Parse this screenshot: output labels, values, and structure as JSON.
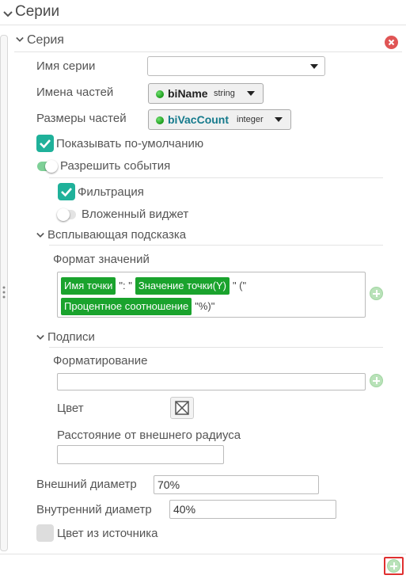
{
  "section": {
    "title": "Серии"
  },
  "series": {
    "title": "Серия",
    "name_label": "Имя серии",
    "name_value": "",
    "parts_names_label": "Имена частей",
    "parts_names_field": {
      "name": "biName",
      "type": "string"
    },
    "parts_sizes_label": "Размеры частей",
    "parts_sizes_field": {
      "name": "biVacCount",
      "type": "integer"
    },
    "show_default_label": "Показывать по-умолчанию",
    "show_default_checked": true,
    "allow_events_label": "Разрешить события",
    "allow_events_on": true,
    "filtering_label": "Фильтрация",
    "filtering_checked": true,
    "nested_widget_label": "Вложенный виджет",
    "nested_widget_on": false
  },
  "tooltip": {
    "title": "Всплывающая подсказка",
    "format_label": "Формат значений",
    "tokens": {
      "point_name": "Имя точки",
      "sep1": "\": \"",
      "point_value": "Значение точки(Y)",
      "sep2": "\" (\"",
      "percent": "Процентное соотношение",
      "sep3": "\"%)\""
    }
  },
  "labels": {
    "title": "Подписи",
    "formatting_label": "Форматирование",
    "formatting_value": "",
    "color_label": "Цвет",
    "outer_distance_label": "Расстояние от внешнего радиуса",
    "outer_distance_value": ""
  },
  "diameters": {
    "outer_label": "Внешний диаметр",
    "outer_value": "70%",
    "inner_label": "Внутренний диаметр",
    "inner_value": "40%"
  },
  "color_from_source": {
    "label": "Цвет из источника",
    "checked": false
  },
  "colors": {
    "accent": "#1fb19a",
    "tag": "#1aa32d",
    "remove": "#e05555",
    "add": "#b9e2b9",
    "highlight": "#e03030"
  },
  "icons": [
    "chevron-down-icon",
    "remove-icon",
    "caret-down-icon",
    "green-dot-icon",
    "check-icon",
    "plus-icon",
    "no-color-icon",
    "resize-handle-icon"
  ]
}
